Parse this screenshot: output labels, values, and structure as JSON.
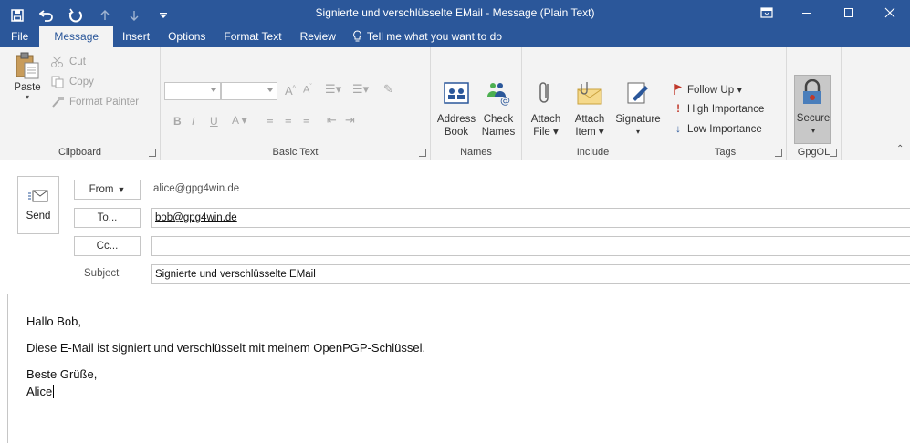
{
  "window": {
    "title": "Signierte und verschlüsselte EMail  -  Message (Plain Text)"
  },
  "tabs": [
    {
      "label": "File"
    },
    {
      "label": "Message"
    },
    {
      "label": "Insert"
    },
    {
      "label": "Options"
    },
    {
      "label": "Format Text"
    },
    {
      "label": "Review"
    }
  ],
  "tell_me": "Tell me what you want to do",
  "ribbon": {
    "clipboard": {
      "label": "Clipboard",
      "paste": "Paste",
      "cut": "Cut",
      "copy": "Copy",
      "format_painter": "Format Painter"
    },
    "basic_text": {
      "label": "Basic Text",
      "bold": "B",
      "italic": "I",
      "underline": "U"
    },
    "names": {
      "label": "Names",
      "address_book_1": "Address",
      "address_book_2": "Book",
      "check_names_1": "Check",
      "check_names_2": "Names"
    },
    "include": {
      "label": "Include",
      "attach_file_1": "Attach",
      "attach_file_2": "File ▾",
      "attach_item_1": "Attach",
      "attach_item_2": "Item ▾",
      "signature": "Signature"
    },
    "tags": {
      "label": "Tags",
      "follow_up": "Follow Up ▾",
      "high_importance": "High Importance",
      "low_importance": "Low Importance"
    },
    "gpgol": {
      "label": "GpgOL",
      "secure": "Secure"
    }
  },
  "compose": {
    "send": "Send",
    "from_button": "From",
    "from_value": "alice@gpg4win.de",
    "to_button": "To...",
    "to_value": "bob@gpg4win.de",
    "cc_button": "Cc...",
    "cc_value": "",
    "subject_label": "Subject",
    "subject_value": "Signierte und verschlüsselte EMail"
  },
  "body": {
    "line1": "Hallo Bob,",
    "line2": "Diese E-Mail ist signiert und verschlüsselt mit meinem OpenPGP-Schlüssel.",
    "line3": "Beste Grüße,",
    "line4": "Alice"
  },
  "colors": {
    "titlebar": "#2b579a",
    "ribbon": "#f3f3f3",
    "follow_up_flag": "#c0392b",
    "high_importance": "#c0392b",
    "low_importance": "#2b579a"
  }
}
